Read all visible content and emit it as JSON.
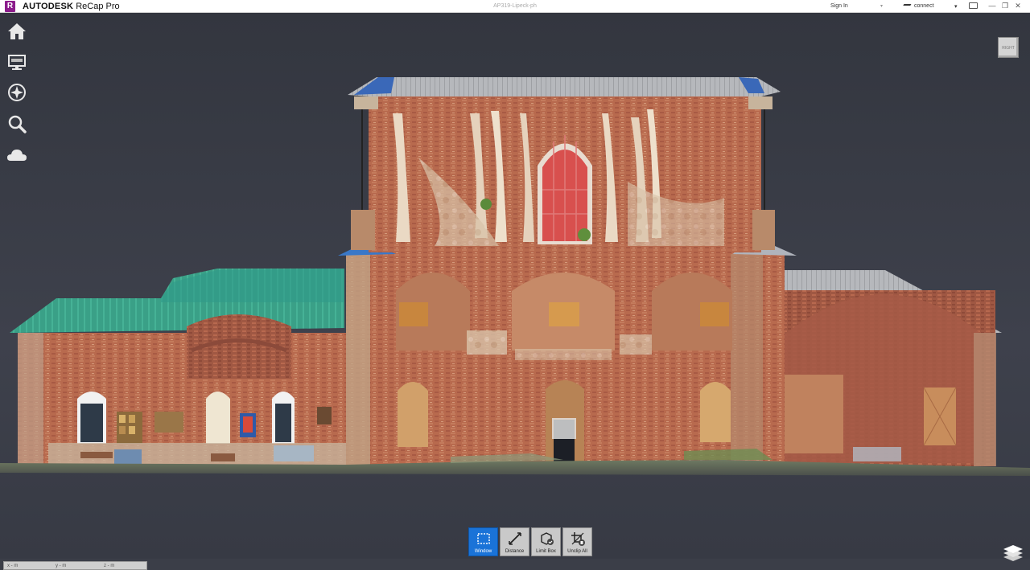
{
  "app": {
    "logo_letter": "R",
    "brand": "AUTODESK",
    "name": "ReCap Pro",
    "document_title": "AP319-Lipeck-ph"
  },
  "titlebar": {
    "signin_label": "Sign In",
    "connect_label": "connect",
    "minimize_glyph": "—",
    "restore_glyph": "❐",
    "close_glyph": "✕",
    "caret_glyph": "▾"
  },
  "navigation": {
    "items": [
      {
        "name": "home",
        "icon": "home-icon"
      },
      {
        "name": "display",
        "icon": "monitor-icon"
      },
      {
        "name": "navigate",
        "icon": "compass-icon"
      },
      {
        "name": "search",
        "icon": "magnifier-icon"
      },
      {
        "name": "cloud",
        "icon": "cloud-icon"
      }
    ]
  },
  "viewcube": {
    "label": "RIGHT"
  },
  "toolbar": {
    "tools": [
      {
        "label": "Window",
        "icon": "window-select-icon",
        "active": true
      },
      {
        "label": "Distance",
        "icon": "distance-icon",
        "active": false
      },
      {
        "label": "Limit Box",
        "icon": "limit-box-icon",
        "active": false
      },
      {
        "label": "Unclip All",
        "icon": "unclip-icon",
        "active": false
      }
    ]
  },
  "coordinates": {
    "x": "x - m",
    "y": "y - m",
    "z": "z - m"
  },
  "colors": {
    "background": "#3b3e48",
    "active_tool": "#1a73d8",
    "logo": "#8c1d8c"
  },
  "scan": {
    "subject": "point-cloud-facade",
    "layers_icon": "layers-icon"
  }
}
